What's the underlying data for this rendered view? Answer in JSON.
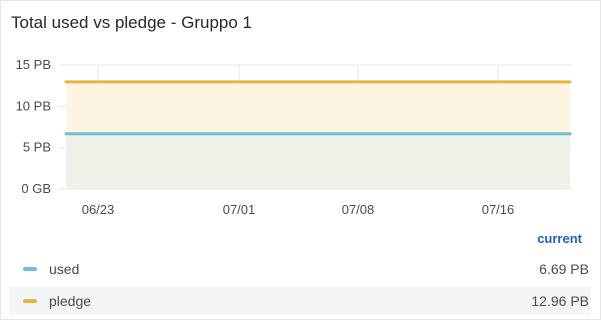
{
  "panel": {
    "title": "Total used vs pledge - Gruppo 1"
  },
  "chart_data": {
    "type": "line",
    "title": "Total used vs pledge - Gruppo 1",
    "xlabel": "",
    "ylabel": "",
    "x_ticks": [
      "06/23",
      "07/01",
      "07/08",
      "07/16"
    ],
    "y_ticks": [
      {
        "value": 0,
        "label": "0 GB"
      },
      {
        "value": 5,
        "label": "5 PB"
      },
      {
        "value": 10,
        "label": "10 PB"
      },
      {
        "value": 15,
        "label": "15 PB"
      }
    ],
    "ylim": [
      0,
      15
    ],
    "grid": true,
    "series": [
      {
        "name": "used",
        "values": [
          6.69,
          6.69
        ],
        "color": "#73bfd0",
        "fill": "#eef1e8"
      },
      {
        "name": "pledge",
        "values": [
          12.96,
          12.96
        ],
        "color": "#e8b43b",
        "fill": "#fdf4e3"
      }
    ]
  },
  "legend": {
    "header": "current",
    "rows": [
      {
        "name": "used",
        "value": "6.69 PB",
        "color": "#73bfd0"
      },
      {
        "name": "pledge",
        "value": "12.96 PB",
        "color": "#e8b43b"
      }
    ]
  }
}
